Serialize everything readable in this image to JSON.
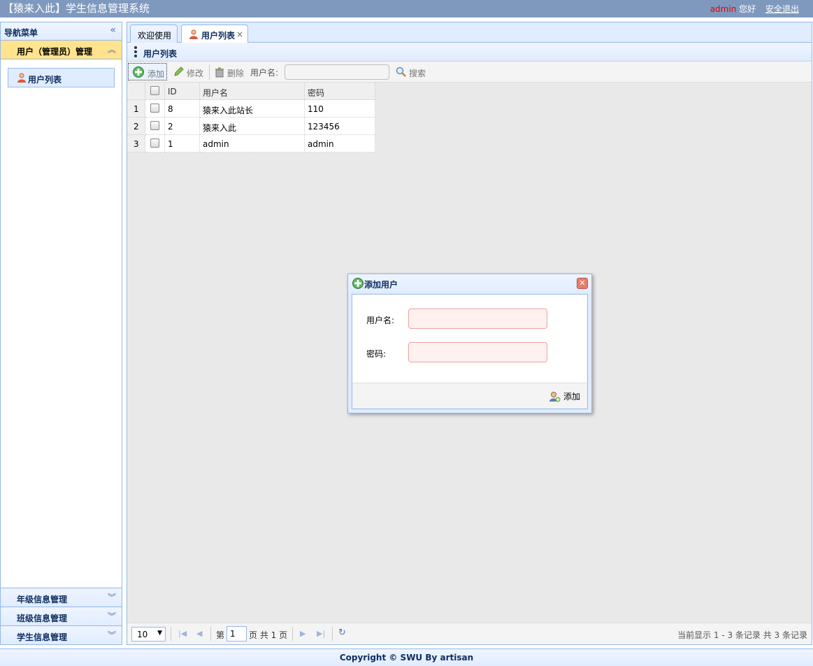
{
  "header": {
    "title": "【猿来入此】学生信息管理系统",
    "username": "admin",
    "greeting": "您好",
    "logout": "安全退出"
  },
  "sidebar": {
    "title": "导航菜单",
    "sections": [
      {
        "label": "用户（管理员）管理",
        "expanded": true,
        "items": [
          {
            "label": "用户列表"
          }
        ]
      },
      {
        "label": "年级信息管理",
        "expanded": false
      },
      {
        "label": "班级信息管理",
        "expanded": false
      },
      {
        "label": "学生信息管理",
        "expanded": false
      }
    ]
  },
  "tabs": [
    {
      "label": "欢迎使用",
      "active": false
    },
    {
      "label": "用户列表",
      "active": true,
      "closable": true,
      "close": "×"
    }
  ],
  "panel": {
    "title": "用户列表"
  },
  "toolbar": {
    "add": "添加",
    "edit": "修改",
    "delete": "删除",
    "search_label": "用户名:",
    "search_value": "",
    "search": "搜索"
  },
  "grid": {
    "columns": [
      "ID",
      "用户名",
      "密码"
    ],
    "rows": [
      {
        "num": "1",
        "id": "8",
        "username": "猿来入此站长",
        "password": "110"
      },
      {
        "num": "2",
        "id": "2",
        "username": "猿来入此",
        "password": "123456"
      },
      {
        "num": "3",
        "id": "1",
        "username": "admin",
        "password": "admin"
      }
    ]
  },
  "pager": {
    "page_size": "10",
    "page_prefix": "第",
    "page": "1",
    "page_suffix": "页 共 1 页",
    "info": "当前显示 1 - 3 条记录 共 3 条记录"
  },
  "dialog": {
    "title": "添加用户",
    "username_label": "用户名:",
    "username_value": "",
    "password_label": "密码:",
    "password_value": "",
    "submit": "添加"
  },
  "footer": {
    "copyright": "Copyright © SWU By artisan"
  }
}
